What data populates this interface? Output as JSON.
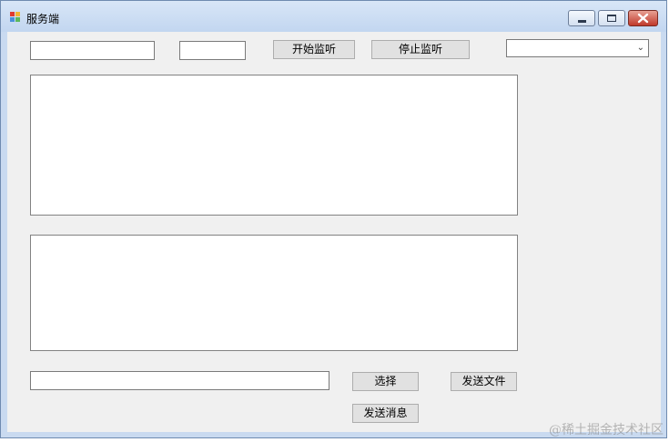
{
  "window": {
    "title": "服务端",
    "icon": "app-window-icon",
    "controls": [
      "minimize-icon",
      "maximize-icon",
      "close-icon"
    ]
  },
  "top_row": {
    "ip_input": {
      "value": "",
      "placeholder": ""
    },
    "port_input": {
      "value": "",
      "placeholder": ""
    },
    "start_label": "开始监听",
    "stop_label": "停止监听",
    "client_select": {
      "selected": ""
    }
  },
  "log_area": {
    "value": ""
  },
  "message_area": {
    "value": ""
  },
  "bottom_row": {
    "file_path_input": {
      "value": "",
      "placeholder": ""
    },
    "choose_label": "选择",
    "send_file_label": "发送文件",
    "send_message_label": "发送消息"
  },
  "watermark": "@稀土掘金技术社区",
  "colors": {
    "titlebar": "#c9daf0",
    "client_bg": "#f0f0f0",
    "button_bg": "#e1e1e1",
    "close_btn": "#c0392b"
  }
}
